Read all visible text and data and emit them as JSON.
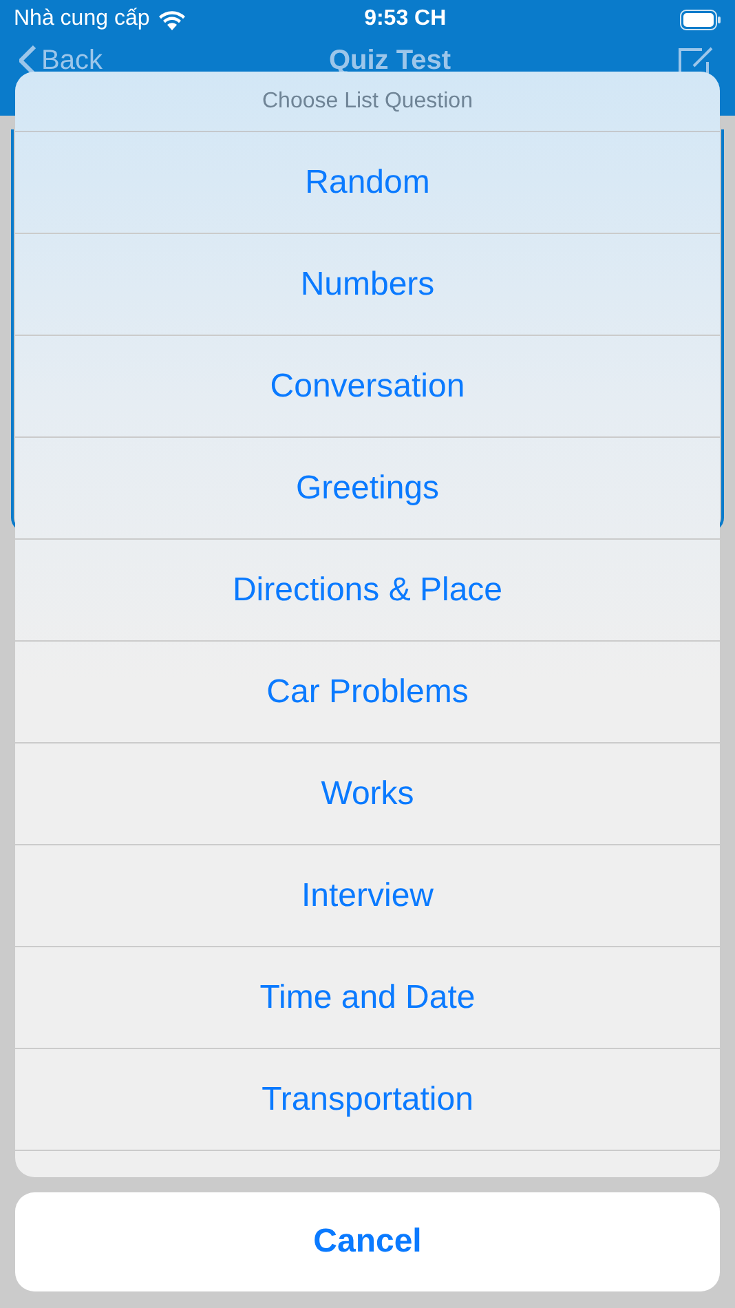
{
  "status_bar": {
    "carrier": "Nhà cung cấp",
    "time": "9:53 CH"
  },
  "nav_bar": {
    "back": "Back",
    "title": "Quiz Test"
  },
  "action_sheet": {
    "title": "Choose List Question",
    "options": [
      "Random",
      "Numbers",
      "Conversation",
      "Greetings",
      "Directions & Place",
      "Car Problems",
      "Works",
      "Interview",
      "Time and Date",
      "Transportation"
    ],
    "cancel": "Cancel"
  }
}
